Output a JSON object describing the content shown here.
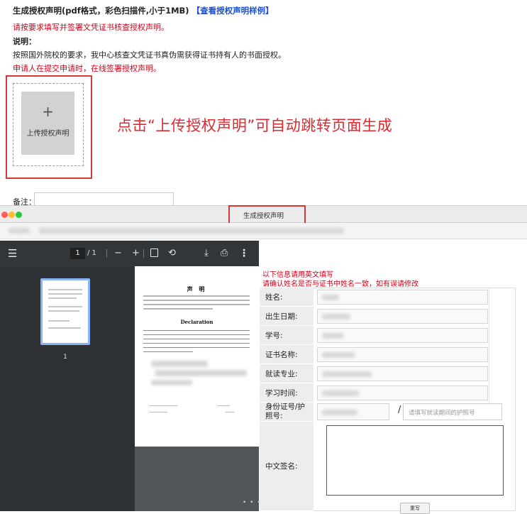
{
  "upload_section": {
    "title": "生成授权声明(pdf格式，彩色扫描件,小于1MB)",
    "sample_link": "【查看授权声明样例】",
    "note": "请按要求填写并签署文凭证书核查授权声明。",
    "explain_label": "说明：",
    "explain_text": "按照国外院校的要求，我中心核查文凭证书真伪需获得证书持有人的书面授权。",
    "note2": "申请人在提交申请时，在线签署授权声明。",
    "upload_plus": "+",
    "upload_button": "上传授权声明",
    "annotation": "点击“上传授权声明”可自动跳转页面生成",
    "remark_label": "备注："
  },
  "window": {
    "title": "生成授权声明"
  },
  "pdf_viewer": {
    "menu_icon": "☰",
    "page_current": "1",
    "page_total": "/ 1",
    "zoom_out": "−",
    "zoom_in": "+",
    "rotate_icon": "⟲",
    "download_icon": "⤓",
    "print_icon": "⎙",
    "more_icon": "⋮",
    "thumbnail_page": "1",
    "doc_heading": "声 明",
    "doc_declaration": "Declaration",
    "scroll_dots": "• • • • • • • •"
  },
  "form": {
    "note1": "以下信息请用英文填写",
    "note2": "请确认姓名是否与证书中姓名一致，如有误请修改",
    "fields": [
      {
        "label": "姓名:"
      },
      {
        "label": "出生日期:"
      },
      {
        "label": "学号:"
      },
      {
        "label": "证书名称:"
      },
      {
        "label": "就读专业:"
      },
      {
        "label": "学习时间:"
      }
    ],
    "id_label_line1": "身份证号/护",
    "id_label_line2": "照号:",
    "id_separator": "/",
    "passport_placeholder": "请填写就读期间的护照号",
    "signature_label": "中文签名:",
    "rewrite_button": "重写"
  }
}
